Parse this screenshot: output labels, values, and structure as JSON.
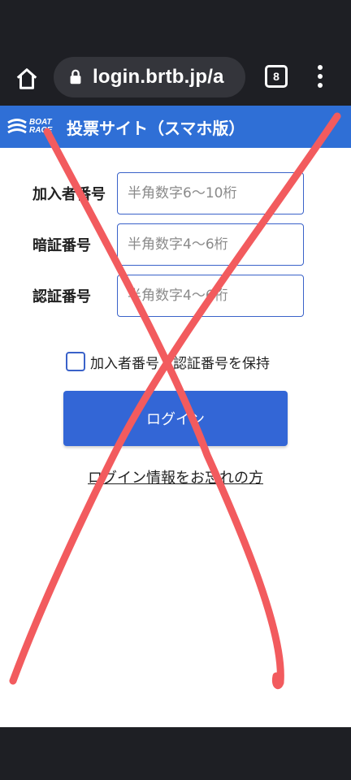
{
  "browser": {
    "url": "login.brtb.jp/a",
    "tab_count": "8"
  },
  "header": {
    "logo_line1": "BOAT",
    "logo_line2": "RACE",
    "title": "投票サイト（スマホ版）"
  },
  "form": {
    "fields": [
      {
        "label": "加入者番号",
        "placeholder": "半角数字6〜10桁"
      },
      {
        "label": "暗証番号",
        "placeholder": "半角数字4〜6桁"
      },
      {
        "label": "認証番号",
        "placeholder": "半角数字4〜6桁"
      }
    ],
    "remember_label": "加入者番号・認証番号を保持",
    "login_label": "ログイン",
    "forgot_label": "ログイン情報をお忘れの方"
  },
  "colors": {
    "header_blue": "#2f6fd6",
    "button_blue": "#3366d6",
    "x_mark": "#f25b5e"
  }
}
